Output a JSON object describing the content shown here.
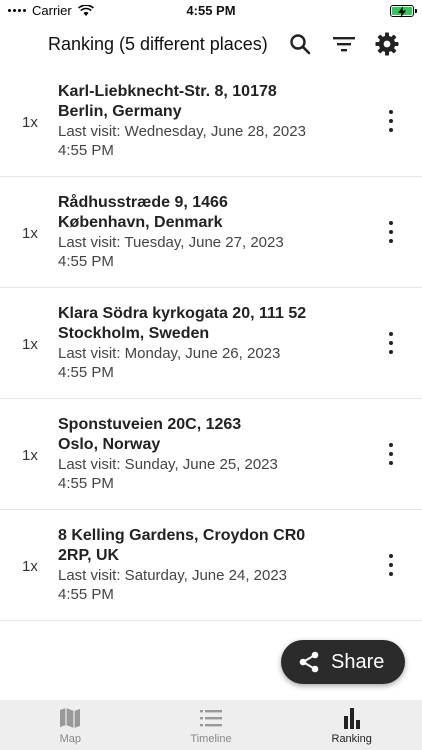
{
  "status_bar": {
    "carrier": "Carrier",
    "time": "4:55 PM"
  },
  "header": {
    "title": "Ranking (5 different places)"
  },
  "places": [
    {
      "count": "1x",
      "line1": "Karl-Liebknecht-Str. 8, 10178",
      "line2": "Berlin, Germany",
      "visit": "Last visit: Wednesday, June 28, 2023",
      "time": "4:55 PM"
    },
    {
      "count": "1x",
      "line1": "Rådhusstræde 9, 1466",
      "line2": "København, Denmark",
      "visit": "Last visit: Tuesday, June 27, 2023",
      "time": "4:55 PM"
    },
    {
      "count": "1x",
      "line1": "Klara Södra kyrkogata 20, 111 52",
      "line2": "Stockholm, Sweden",
      "visit": "Last visit: Monday, June 26, 2023",
      "time": "4:55 PM"
    },
    {
      "count": "1x",
      "line1": "Sponstuveien 20C, 1263",
      "line2": "Oslo, Norway",
      "visit": "Last visit: Sunday, June 25, 2023",
      "time": "4:55 PM"
    },
    {
      "count": "1x",
      "line1": "8 Kelling Gardens, Croydon CR0",
      "line2": "2RP, UK",
      "visit": "Last visit: Saturday, June 24, 2023",
      "time": "4:55 PM"
    }
  ],
  "share_button": {
    "label": "Share"
  },
  "bottom_nav": {
    "items": [
      {
        "label": "Map",
        "icon": "map-icon"
      },
      {
        "label": "Timeline",
        "icon": "list-icon"
      },
      {
        "label": "Ranking",
        "icon": "bar-chart-icon"
      }
    ],
    "active": "Ranking"
  },
  "colors": {
    "battery": "#34c759",
    "fab": "#2b2b2b",
    "nav_bg": "#eeeeee"
  }
}
